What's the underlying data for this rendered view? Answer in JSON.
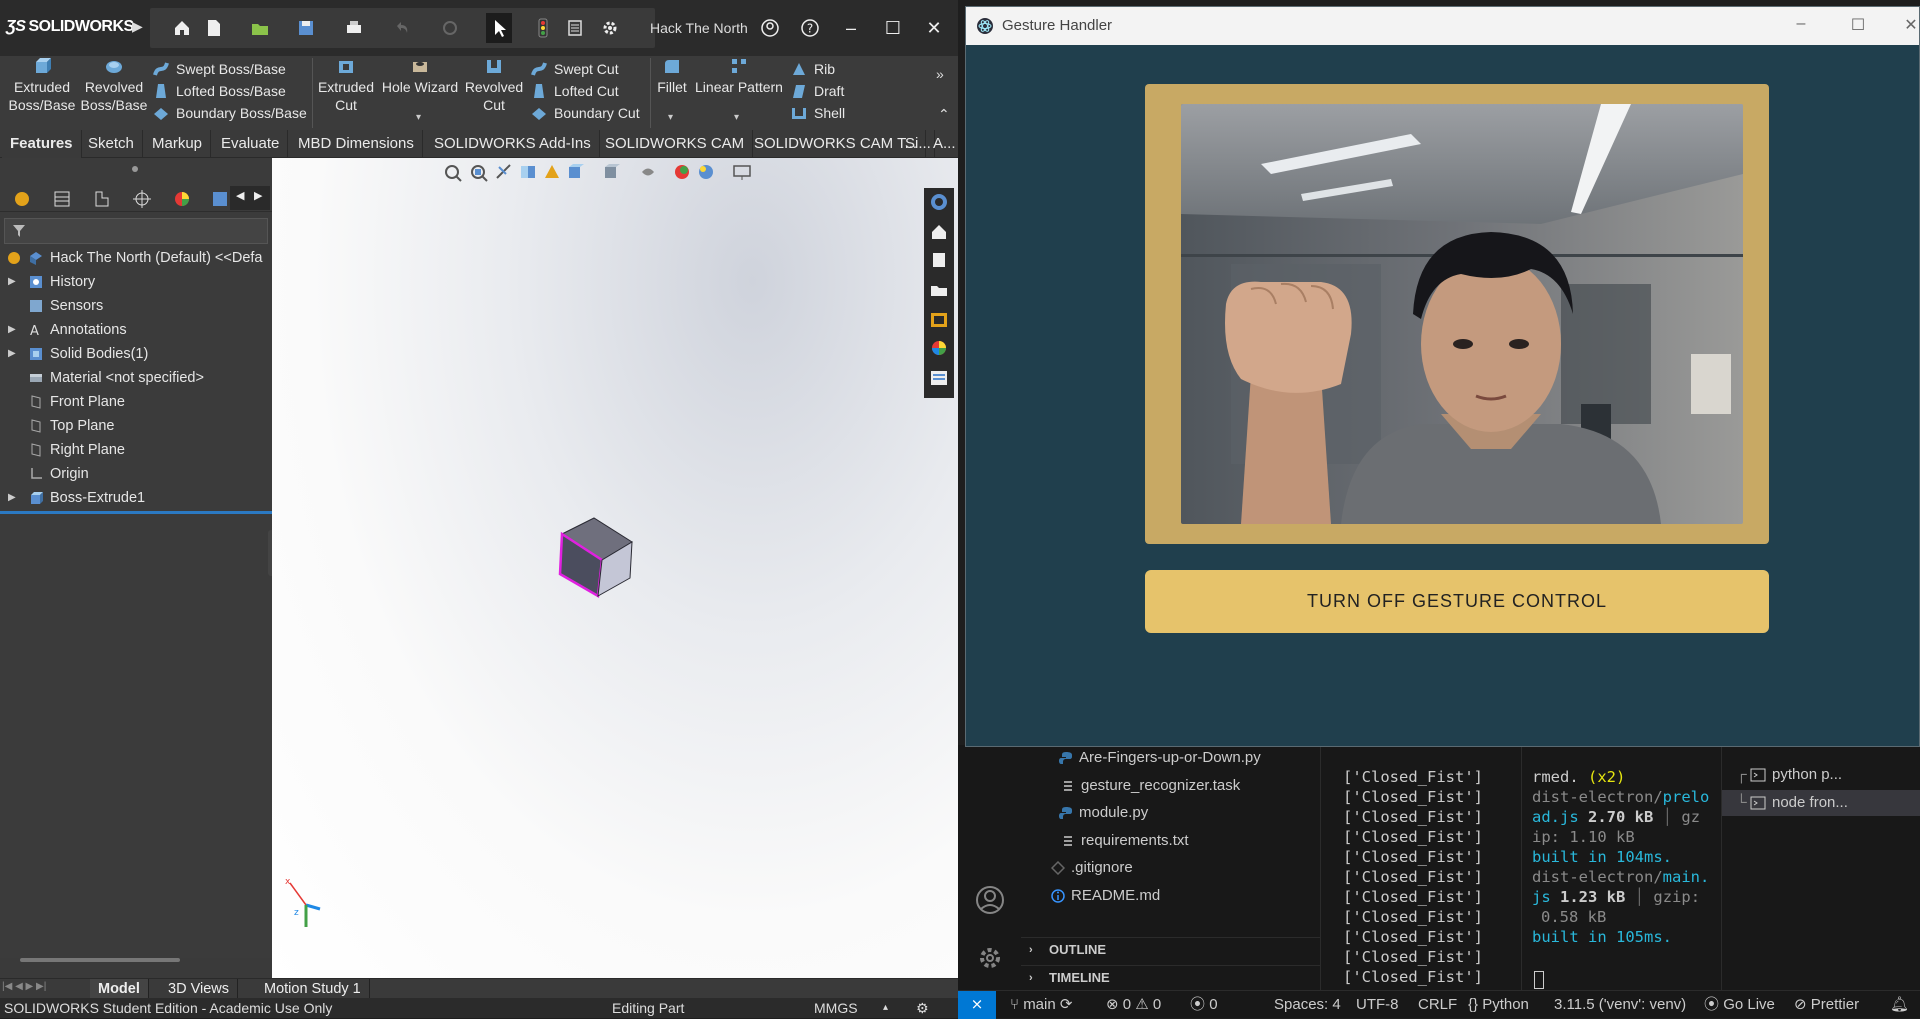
{
  "solidworks": {
    "brand": "SOLIDWORKS",
    "doc_title": "Hack The North",
    "command_manager": {
      "extruded_boss": [
        "Extruded",
        "Boss/Base"
      ],
      "revolved_boss": [
        "Revolved",
        "Boss/Base"
      ],
      "swept_boss": "Swept Boss/Base",
      "lofted_boss": "Lofted Boss/Base",
      "boundary_boss": "Boundary Boss/Base",
      "extruded_cut": [
        "Extruded",
        "Cut"
      ],
      "hole_wizard": "Hole Wizard",
      "revolved_cut": [
        "Revolved",
        "Cut"
      ],
      "swept_cut": "Swept Cut",
      "lofted_cut": "Lofted Cut",
      "boundary_cut": "Boundary Cut",
      "fillet": "Fillet",
      "linear_pattern": "Linear Pattern",
      "rib": "Rib",
      "draft": "Draft",
      "shell": "Shell"
    },
    "tabs": [
      "Features",
      "Sketch",
      "Markup",
      "Evaluate",
      "MBD Dimensions",
      "SOLIDWORKS Add-Ins",
      "SOLIDWORKS CAM",
      "SOLIDWORKS CAM T...",
      "Si...",
      "A..."
    ],
    "feature_tree": [
      {
        "label": "Hack The North (Default) <<Defa",
        "expandable": false
      },
      {
        "label": "History",
        "expandable": true
      },
      {
        "label": "Sensors",
        "expandable": false
      },
      {
        "label": "Annotations",
        "expandable": true
      },
      {
        "label": "Solid Bodies(1)",
        "expandable": true
      },
      {
        "label": "Material <not specified>",
        "expandable": false
      },
      {
        "label": "Front Plane",
        "expandable": false
      },
      {
        "label": "Top Plane",
        "expandable": false
      },
      {
        "label": "Right Plane",
        "expandable": false
      },
      {
        "label": "Origin",
        "expandable": false
      },
      {
        "label": "Boss-Extrude1",
        "expandable": true
      }
    ],
    "bottom_tabs": [
      "Model",
      "3D Views",
      "Motion Study 1"
    ],
    "status": {
      "edition": "SOLIDWORKS Student Edition - Academic Use Only",
      "mode": "Editing Part",
      "units": "MMGS"
    }
  },
  "gesture_handler": {
    "window_title": "Gesture Handler",
    "toggle_button_label": "TURN OFF GESTURE CONTROL"
  },
  "vscode": {
    "explorer_files": [
      {
        "name": "Are-Fingers-up-or-Down.py",
        "icon": "python-icon"
      },
      {
        "name": "gesture_recognizer.task",
        "icon": "file-lines-icon"
      },
      {
        "name": "module.py",
        "icon": "python-icon"
      },
      {
        "name": "requirements.txt",
        "icon": "file-lines-icon"
      },
      {
        "name": ".gitignore",
        "icon": "git-icon"
      },
      {
        "name": "README.md",
        "icon": "info-icon"
      }
    ],
    "sections": [
      "OUTLINE",
      "TIMELINE"
    ],
    "terminal_output": [
      "['Closed_Fist']",
      "['Closed_Fist']",
      "['Closed_Fist']",
      "['Closed_Fist']",
      "['Closed_Fist']",
      "['Closed_Fist']",
      "['Closed_Fist']",
      "['Closed_Fist']",
      "['Closed_Fist']",
      "['Closed_Fist']",
      "['Closed_Fist']"
    ],
    "build_output": {
      "l1a": "rmed.",
      "l1b": "(x2)",
      "l2a": "dist-electron/",
      "l2b": "prelo",
      "l3a": "ad.js",
      "l3b": "2.70 kB",
      "l3c": "gz",
      "l4": "ip: 1.10 kB",
      "l5": "built in 104ms.",
      "l6a": "dist-electron/",
      "l6b": "main.",
      "l7a": "js",
      "l7b": "1.23 kB",
      "l7c": "gzip:",
      "l8": "0.58 kB",
      "l9": "built in 105ms."
    },
    "terminals": [
      "python p...",
      "node fron..."
    ],
    "status_bar": {
      "branch": "main",
      "errors": "0",
      "warnings": "0",
      "ports": "0",
      "spaces": "Spaces: 4",
      "encoding": "UTF-8",
      "eol": "CRLF",
      "language": "Python",
      "interpreter": "3.11.5 ('venv': venv)",
      "go_live": "Go Live",
      "prettier": "Prettier"
    }
  },
  "colors": {
    "gh_background": "#203f4d",
    "gh_frame": "#c8a964",
    "gh_button": "#e6c36b",
    "sw_dark": "#3a3a3a",
    "vs_blue": "#3794ff"
  }
}
